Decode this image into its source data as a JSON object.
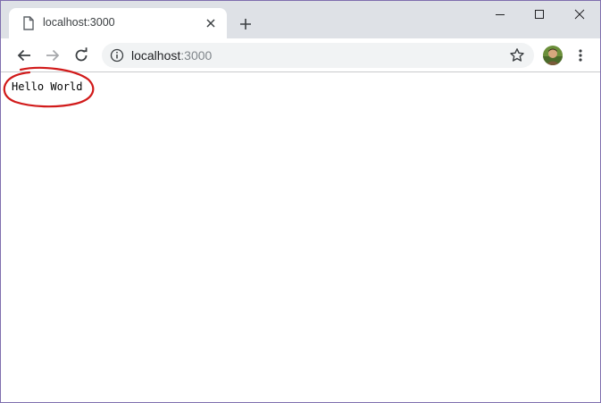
{
  "browser": {
    "tab": {
      "title": "localhost:3000",
      "icon": "document-icon",
      "close_icon": "close-icon"
    },
    "new_tab_icon": "plus-icon",
    "window_controls": [
      "minimize-icon",
      "maximize-icon",
      "close-icon"
    ],
    "toolbar": {
      "back_icon": "back-arrow-icon",
      "forward_icon": "forward-arrow-icon",
      "reload_icon": "reload-icon",
      "address": {
        "host": "localhost",
        "port": ":3000",
        "security_icon": "info-icon"
      },
      "bookmark_icon": "star-icon",
      "profile_icon": "avatar",
      "menu_icon": "kebab-menu-icon"
    }
  },
  "page": {
    "body_text": "Hello World"
  },
  "colors": {
    "titlebar": "#dee1e6",
    "omnibox": "#f1f3f4",
    "annotation": "#d11a1a",
    "window_border": "#7f6fae"
  }
}
